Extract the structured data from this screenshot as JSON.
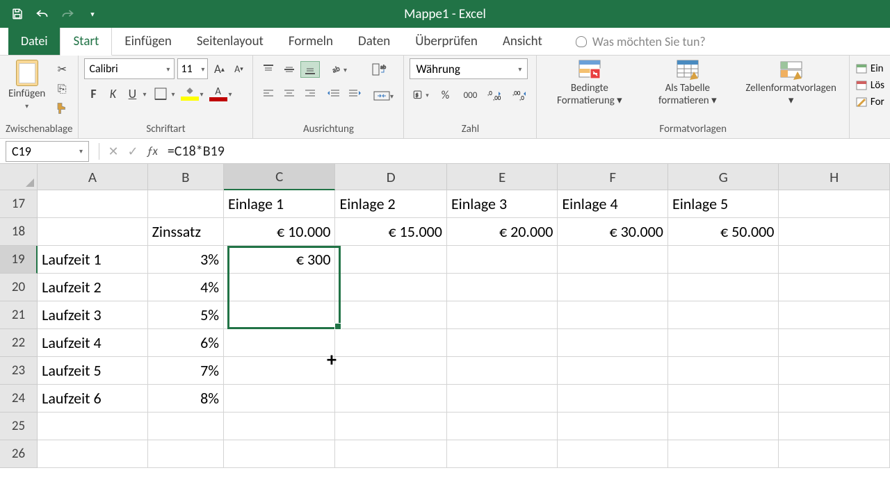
{
  "app": {
    "title": "Mappe1 - Excel"
  },
  "tabs": {
    "file": "Datei",
    "start": "Start",
    "einfuegen": "Einfügen",
    "seitenlayout": "Seitenlayout",
    "formeln": "Formeln",
    "daten": "Daten",
    "ueberpruefen": "Überprüfen",
    "ansicht": "Ansicht",
    "tellme": "Was möchten Sie tun?"
  },
  "ribbon": {
    "clipboard": {
      "paste": "Einfügen",
      "group": "Zwischenablage"
    },
    "font": {
      "name": "Calibri",
      "size": "11",
      "group": "Schriftart"
    },
    "alignment": {
      "group": "Ausrichtung"
    },
    "number": {
      "format": "Währung",
      "group": "Zahl"
    },
    "styles": {
      "cond": "Bedingte Formatierung",
      "table": "Als Tabelle formatieren",
      "cellstyles": "Zellenformatvorlagen",
      "group": "Formatvorlagen"
    },
    "cells": {
      "ein": "Ein",
      "los": "Lös",
      "for": "For"
    }
  },
  "formula": {
    "ref": "C19",
    "content": "=C18*B19"
  },
  "columns": [
    "A",
    "B",
    "C",
    "D",
    "E",
    "F",
    "G",
    "H"
  ],
  "rows": [
    "17",
    "18",
    "19",
    "20",
    "21",
    "22",
    "23",
    "24",
    "25",
    "26"
  ],
  "data": {
    "r17": {
      "C": "Einlage 1",
      "D": "Einlage 2",
      "E": "Einlage 3",
      "F": "Einlage 4",
      "G": "Einlage 5"
    },
    "r18": {
      "B": "Zinssatz",
      "C": "€ 10.000",
      "D": "€ 15.000",
      "E": "€ 20.000",
      "F": "€ 30.000",
      "G": "€ 50.000"
    },
    "r19": {
      "A": "Laufzeit 1",
      "B": "3%",
      "C": "€ 300"
    },
    "r20": {
      "A": "Laufzeit 2",
      "B": "4%"
    },
    "r21": {
      "A": "Laufzeit 3",
      "B": "5%"
    },
    "r22": {
      "A": "Laufzeit 4",
      "B": "6%"
    },
    "r23": {
      "A": "Laufzeit 5",
      "B": "7%"
    },
    "r24": {
      "A": "Laufzeit 6",
      "B": "8%"
    }
  }
}
